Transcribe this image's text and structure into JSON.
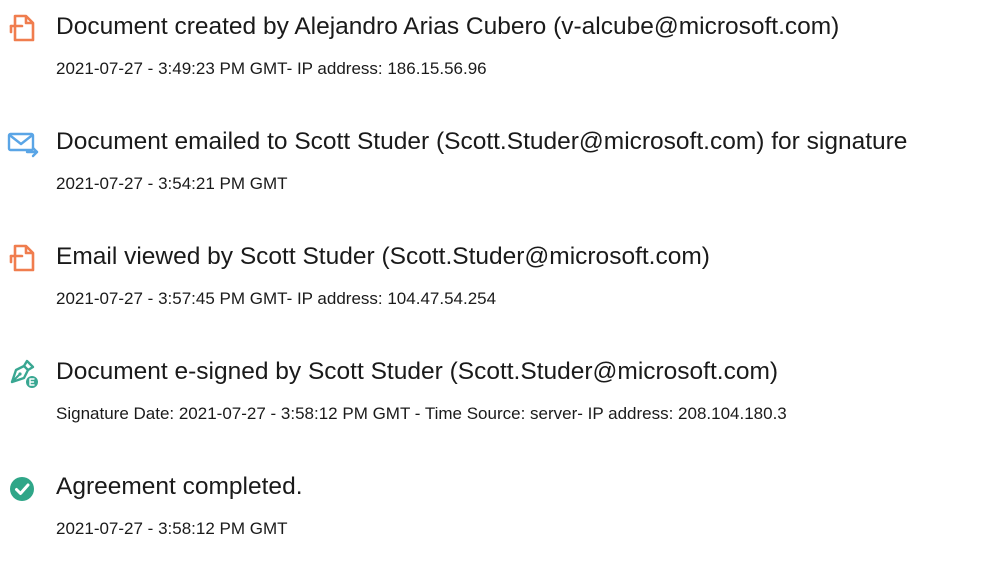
{
  "events": [
    {
      "icon": "document-icon",
      "title": "Document created by Alejandro Arias Cubero (v-alcube@microsoft.com)",
      "detail": "2021-07-27 - 3:49:23 PM GMT- IP address: 186.15.56.96"
    },
    {
      "icon": "email-sent-icon",
      "title": "Document emailed to Scott Studer (Scott.Studer@microsoft.com) for signature",
      "detail": "2021-07-27 - 3:54:21 PM GMT"
    },
    {
      "icon": "document-icon",
      "title": "Email viewed by Scott Studer (Scott.Studer@microsoft.com)",
      "detail": "2021-07-27 - 3:57:45 PM GMT- IP address: 104.47.54.254"
    },
    {
      "icon": "e-signature-pen-icon",
      "title": "Document e-signed by Scott Studer (Scott.Studer@microsoft.com)",
      "detail": "Signature Date: 2021-07-27 - 3:58:12 PM GMT - Time Source: server- IP address: 208.104.180.3"
    },
    {
      "icon": "check-circle-icon",
      "title": "Agreement completed.",
      "detail": "2021-07-27 - 3:58:12 PM GMT"
    }
  ],
  "colors": {
    "document_icon": "#f07d4e",
    "email_icon": "#5aa5e6",
    "signature_icon": "#39a792",
    "complete_icon": "#2fa688",
    "text": "#1a1a1a"
  }
}
